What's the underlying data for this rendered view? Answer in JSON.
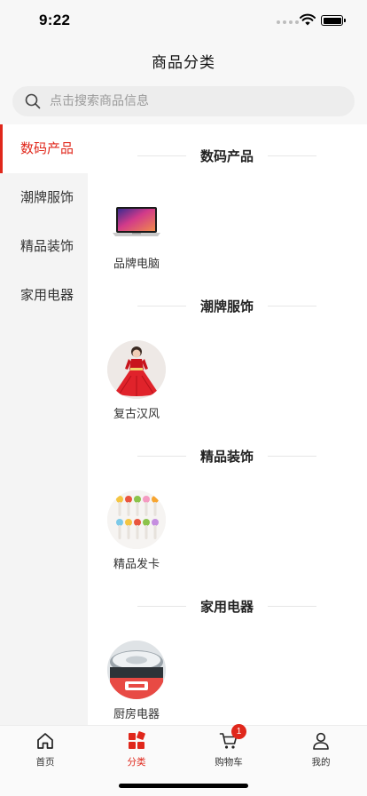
{
  "status_bar": {
    "time": "9:22",
    "icons": [
      "signal-dots-icon",
      "wifi-icon",
      "battery-icon"
    ]
  },
  "nav": {
    "title": "商品分类"
  },
  "search": {
    "placeholder": "点击搜索商品信息",
    "value": "",
    "icon": "search-icon"
  },
  "colors": {
    "accent": "#e0271b",
    "sidebar_bg": "#f4f4f4",
    "header_bg": "#f7f7f7"
  },
  "sidebar": {
    "items": [
      {
        "label": "数码产品",
        "active": true
      },
      {
        "label": "潮牌服饰",
        "active": false
      },
      {
        "label": "精品装饰",
        "active": false
      },
      {
        "label": "家用电器",
        "active": false
      }
    ]
  },
  "sections": [
    {
      "title": "数码产品",
      "products": [
        {
          "name": "品牌电脑",
          "image": "laptop-image"
        }
      ]
    },
    {
      "title": "潮牌服饰",
      "products": [
        {
          "name": "复古汉风",
          "image": "red-dress-image"
        }
      ]
    },
    {
      "title": "精品装饰",
      "products": [
        {
          "name": "精品发卡",
          "image": "hairpins-image"
        }
      ]
    },
    {
      "title": "家用电器",
      "products": [
        {
          "name": "厨房电器",
          "image": "kitchen-appliance-image"
        }
      ]
    }
  ],
  "tab_bar": {
    "tabs": [
      {
        "label": "首页",
        "icon": "home-icon",
        "active": false
      },
      {
        "label": "分类",
        "icon": "category-grid-icon",
        "active": true
      },
      {
        "label": "购物车",
        "icon": "cart-icon",
        "active": false,
        "badge": "1"
      },
      {
        "label": "我的",
        "icon": "user-icon",
        "active": false
      }
    ]
  }
}
